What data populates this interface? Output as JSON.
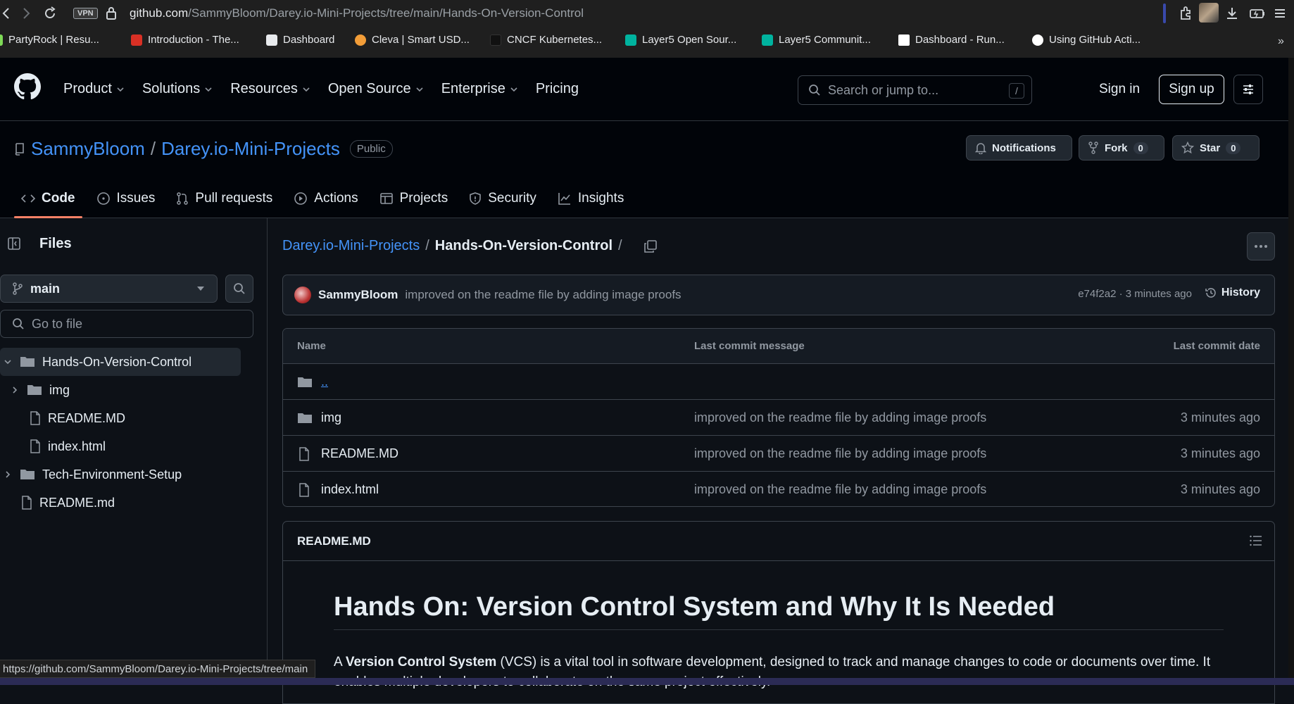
{
  "browser": {
    "vpn_label": "VPN",
    "url_host": "github.com",
    "url_path": "/SammyBloom/Darey.io-Mini-Projects/tree/main/Hands-On-Version-Control",
    "bookmarks": [
      {
        "label": "PartyRock | Resu...",
        "color": "#7ed957"
      },
      {
        "label": "Introduction - The...",
        "color": "#d93025"
      },
      {
        "label": "Dashboard",
        "color": "#e8eaed"
      },
      {
        "label": "Cleva | Smart USD...",
        "color": "#f29d38"
      },
      {
        "label": "CNCF Kubernetes...",
        "color": "#1a1a1a"
      },
      {
        "label": "Layer5 Open Sour...",
        "color": "#00b39f"
      },
      {
        "label": "Layer5 Communit...",
        "color": "#00b39f"
      },
      {
        "label": "Dashboard - Run...",
        "color": "#ffffff"
      },
      {
        "label": "Using GitHub Acti...",
        "color": "#ffffff"
      }
    ],
    "status_url": "https://github.com/SammyBloom/Darey.io-Mini-Projects/tree/main"
  },
  "header": {
    "nav": [
      "Product",
      "Solutions",
      "Resources",
      "Open Source",
      "Enterprise",
      "Pricing"
    ],
    "search_placeholder": "Search or jump to...",
    "search_key": "/",
    "sign_in": "Sign in",
    "sign_up": "Sign up"
  },
  "repo": {
    "owner": "SammyBloom",
    "name": "Darey.io-Mini-Projects",
    "visibility": "Public",
    "notifications_label": "Notifications",
    "fork_label": "Fork",
    "fork_count": "0",
    "star_label": "Star",
    "star_count": "0",
    "tabs": [
      "Code",
      "Issues",
      "Pull requests",
      "Actions",
      "Projects",
      "Security",
      "Insights"
    ]
  },
  "sidebar": {
    "title": "Files",
    "branch": "main",
    "goto_placeholder": "Go to file",
    "tree": [
      {
        "label": "Hands-On-Version-Control"
      },
      {
        "label": "img"
      },
      {
        "label": "README.MD"
      },
      {
        "label": "index.html"
      },
      {
        "label": "Tech-Environment-Setup"
      },
      {
        "label": "README.md"
      }
    ]
  },
  "main": {
    "breadcrumb_repo": "Darey.io-Mini-Projects",
    "breadcrumb_dir": "Hands-On-Version-Control",
    "commit": {
      "author": "SammyBloom",
      "message": "improved on the readme file by adding image proofs",
      "hash_time": "e74f2a2 · 3 minutes ago",
      "history": "History"
    },
    "table": {
      "col_name": "Name",
      "col_msg": "Last commit message",
      "col_date": "Last commit date",
      "up_dir": "..",
      "rows": [
        {
          "name": "img",
          "msg": "improved on the readme file by adding image proofs",
          "date": "3 minutes ago"
        },
        {
          "name": "README.MD",
          "msg": "improved on the readme file by adding image proofs",
          "date": "3 minutes ago"
        },
        {
          "name": "index.html",
          "msg": "improved on the readme file by adding image proofs",
          "date": "3 minutes ago"
        }
      ]
    },
    "readme": {
      "filename": "README.MD",
      "heading": "Hands On: Version Control System and Why It Is Needed",
      "para_lead": "A ",
      "para_bold": "Version Control System",
      "para_rest": " (VCS) is a vital tool in software development, designed to track and manage changes to code or documents over time. It enables multiple developers to collaborate on the same project effectively."
    }
  }
}
